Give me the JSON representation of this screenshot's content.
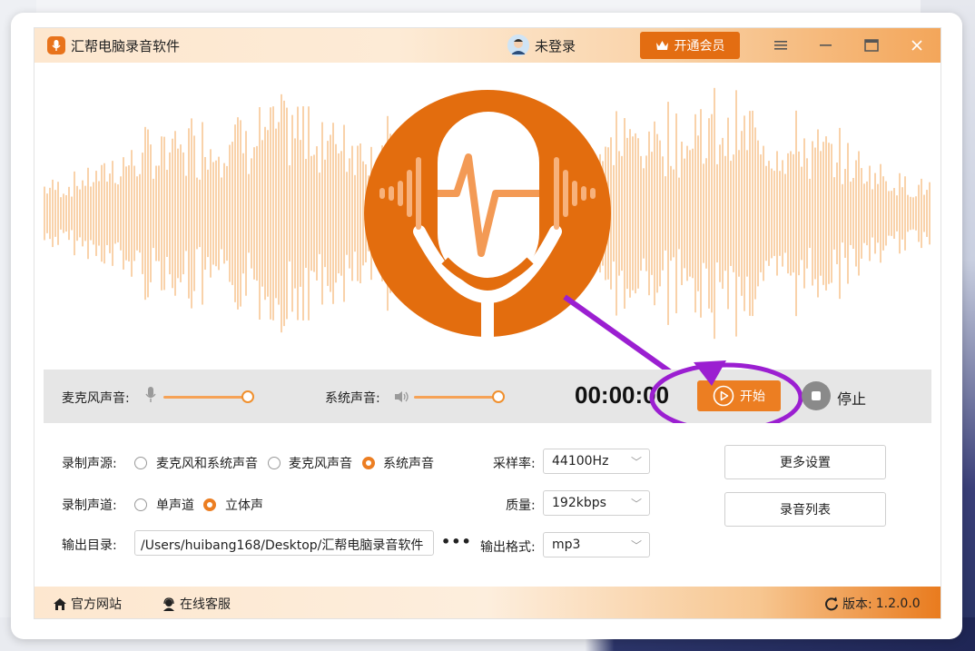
{
  "app": {
    "title": "汇帮电脑录音软件"
  },
  "header": {
    "user_status": "未登录",
    "vip_label": "开通会员"
  },
  "controls": {
    "mic_label": "麦克风声音:",
    "mic_volume": 1.0,
    "system_label": "系统声音:",
    "system_volume": 1.0,
    "timer": "00:00:00",
    "start_label": "开始",
    "stop_label": "停止"
  },
  "settings": {
    "source_label": "录制声源:",
    "source_options": [
      "麦克风和系统声音",
      "麦克风声音",
      "系统声音"
    ],
    "source_selected": "系统声音",
    "channel_label": "录制声道:",
    "channel_options": [
      "单声道",
      "立体声"
    ],
    "channel_selected": "立体声",
    "output_dir_label": "输出目录:",
    "output_dir_value": "/Users/huibang168/Desktop/汇帮电脑录音软件",
    "more_dots": "•••",
    "sample_rate_label": "采样率:",
    "sample_rate_value": "44100Hz",
    "quality_label": "质量:",
    "quality_value": "192kbps",
    "format_label": "输出格式:",
    "format_value": "mp3",
    "more_settings_label": "更多设置",
    "record_list_label": "录音列表"
  },
  "footer": {
    "website_label": "官方网站",
    "service_label": "在线客服",
    "version_label": "版本:",
    "version_value": "1.2.0.0"
  },
  "colors": {
    "accent": "#ec7e22",
    "brand": "#e36d12",
    "annotation": "#9b1fd1"
  }
}
